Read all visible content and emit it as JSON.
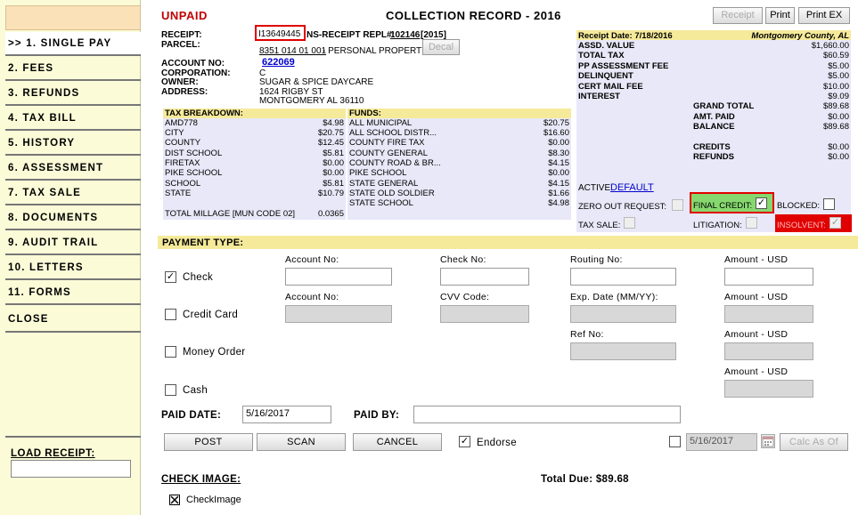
{
  "sidebar": {
    "items": [
      {
        "label": ">> 1. SINGLE PAY",
        "active": true
      },
      {
        "label": "2. FEES"
      },
      {
        "label": "3. REFUNDS"
      },
      {
        "label": "4. TAX BILL"
      },
      {
        "label": "5. HISTORY"
      },
      {
        "label": "6. ASSESSMENT"
      },
      {
        "label": "7. TAX SALE"
      },
      {
        "label": "8. DOCUMENTS"
      },
      {
        "label": "9. AUDIT TRAIL"
      },
      {
        "label": "10. LETTERS"
      },
      {
        "label": "11. FORMS"
      },
      {
        "label": "CLOSE"
      }
    ],
    "load_receipt_label": "LOAD RECEIPT:"
  },
  "header": {
    "status": "UNPAID",
    "title": "COLLECTION RECORD - 2016",
    "receipt_btn": "Receipt",
    "print_btn": "Print",
    "print_ex_btn": "Print EX"
  },
  "info": {
    "receipt_label": "RECEIPT:",
    "receipt_value": "I13649445",
    "ns_label": "NS-RECEIPT REPL#:",
    "ns_value": "102146",
    "ns_year": "[2015]",
    "parcel_label": "PARCEL:",
    "parcel_value": "8351 014 01 001",
    "parcel_desc": "- PERSONAL PROPERTY",
    "decal_btn": "Decal",
    "account_label": "ACCOUNT NO:",
    "account_value": "622069",
    "corp_label": "CORPORATION:",
    "corp_value": "C",
    "owner_label": "OWNER:",
    "owner_value": "SUGAR & SPICE DAYCARE",
    "address_label": "ADDRESS:",
    "address_line1": "1624 RIGBY ST",
    "address_line2": "MONTGOMERY AL   36110"
  },
  "tax_breakdown": {
    "title": "TAX BREAKDOWN:",
    "rows": [
      {
        "name": "AMD778",
        "value": "$4.98"
      },
      {
        "name": "CITY",
        "value": "$20.75"
      },
      {
        "name": "COUNTY",
        "value": "$12.45"
      },
      {
        "name": "DIST SCHOOL",
        "value": "$5.81"
      },
      {
        "name": "FIRETAX",
        "value": "$0.00"
      },
      {
        "name": "PIKE SCHOOL",
        "value": "$0.00"
      },
      {
        "name": "SCHOOL",
        "value": "$5.81"
      },
      {
        "name": "STATE",
        "value": "$10.79"
      }
    ],
    "millage_label": "TOTAL MILLAGE [MUN CODE 02]",
    "millage_value": "0.0365"
  },
  "funds": {
    "title": "FUNDS:",
    "rows": [
      {
        "name": "ALL MUNICIPAL",
        "value": "$20.75"
      },
      {
        "name": "ALL SCHOOL DISTR...",
        "value": "$16.60"
      },
      {
        "name": "COUNTY FIRE TAX",
        "value": "$0.00"
      },
      {
        "name": "COUNTY GENERAL",
        "value": "$8.30"
      },
      {
        "name": "COUNTY ROAD & BR...",
        "value": "$4.15"
      },
      {
        "name": "PIKE SCHOOL",
        "value": "$0.00"
      },
      {
        "name": "STATE GENERAL",
        "value": "$4.15"
      },
      {
        "name": "STATE OLD SOLDIER",
        "value": "$1.66"
      },
      {
        "name": "STATE SCHOOL",
        "value": "$4.98"
      }
    ]
  },
  "summary": {
    "receipt_date": "Receipt Date: 7/18/2016",
    "county": "Montgomery County, AL",
    "left_rows": [
      {
        "label": "ASSD. VALUE",
        "value": "$1,660.00"
      },
      {
        "label": "TOTAL TAX",
        "value": "$60.59"
      },
      {
        "label": "PP ASSESSMENT FEE",
        "value": "$5.00"
      },
      {
        "label": "DELINQUENT",
        "value": "$5.00"
      },
      {
        "label": "CERT MAIL FEE",
        "value": "$10.00"
      },
      {
        "label": "INTEREST",
        "value": "$9.09"
      }
    ],
    "right_rows": [
      {
        "label": "GRAND TOTAL",
        "value": "$89.68"
      },
      {
        "label": "AMT. PAID",
        "value": "$0.00"
      },
      {
        "label": "BALANCE",
        "value": "$89.68"
      }
    ],
    "credit_rows": [
      {
        "label": "CREDITS",
        "value": "$0.00"
      },
      {
        "label": "REFUNDS",
        "value": "$0.00"
      }
    ],
    "active_label": "ACTIVE:",
    "active_value": "DEFAULT",
    "zero_out_label": "ZERO OUT REQUEST:",
    "final_credit_label": "FINAL CREDIT:",
    "blocked_label": "BLOCKED:",
    "tax_sale_label": "TAX SALE:",
    "litigation_label": "LITIGATION:",
    "insolvent_label": "INSOLVENT:"
  },
  "payment": {
    "title": "PAYMENT TYPE:",
    "check": {
      "label": "Check",
      "account_lbl": "Account No:",
      "check_lbl": "Check No:",
      "routing_lbl": "Routing No:",
      "amount_lbl": "Amount - USD"
    },
    "credit": {
      "label": "Credit Card",
      "account_lbl": "Account No:",
      "cvv_lbl": "CVV Code:",
      "exp_lbl": "Exp. Date (MM/YY):",
      "amount_lbl": "Amount - USD"
    },
    "money_order": {
      "label": "Money Order",
      "ref_lbl": "Ref No:",
      "amount_lbl": "Amount - USD"
    },
    "cash": {
      "label": "Cash",
      "amount_lbl": "Amount - USD"
    },
    "paid_date_label": "PAID DATE:",
    "paid_date_value": "5/16/2017",
    "paid_by_label": "PAID BY:",
    "post_btn": "POST",
    "scan_btn": "SCAN",
    "cancel_btn": "CANCEL",
    "endorse_label": "Endorse",
    "calc_date": "5/16/2017",
    "calc_btn": "Calc As Of",
    "check_image_label": "CHECK IMAGE:",
    "check_image_item": "CheckImage",
    "total_due": "Total Due: $89.68"
  }
}
